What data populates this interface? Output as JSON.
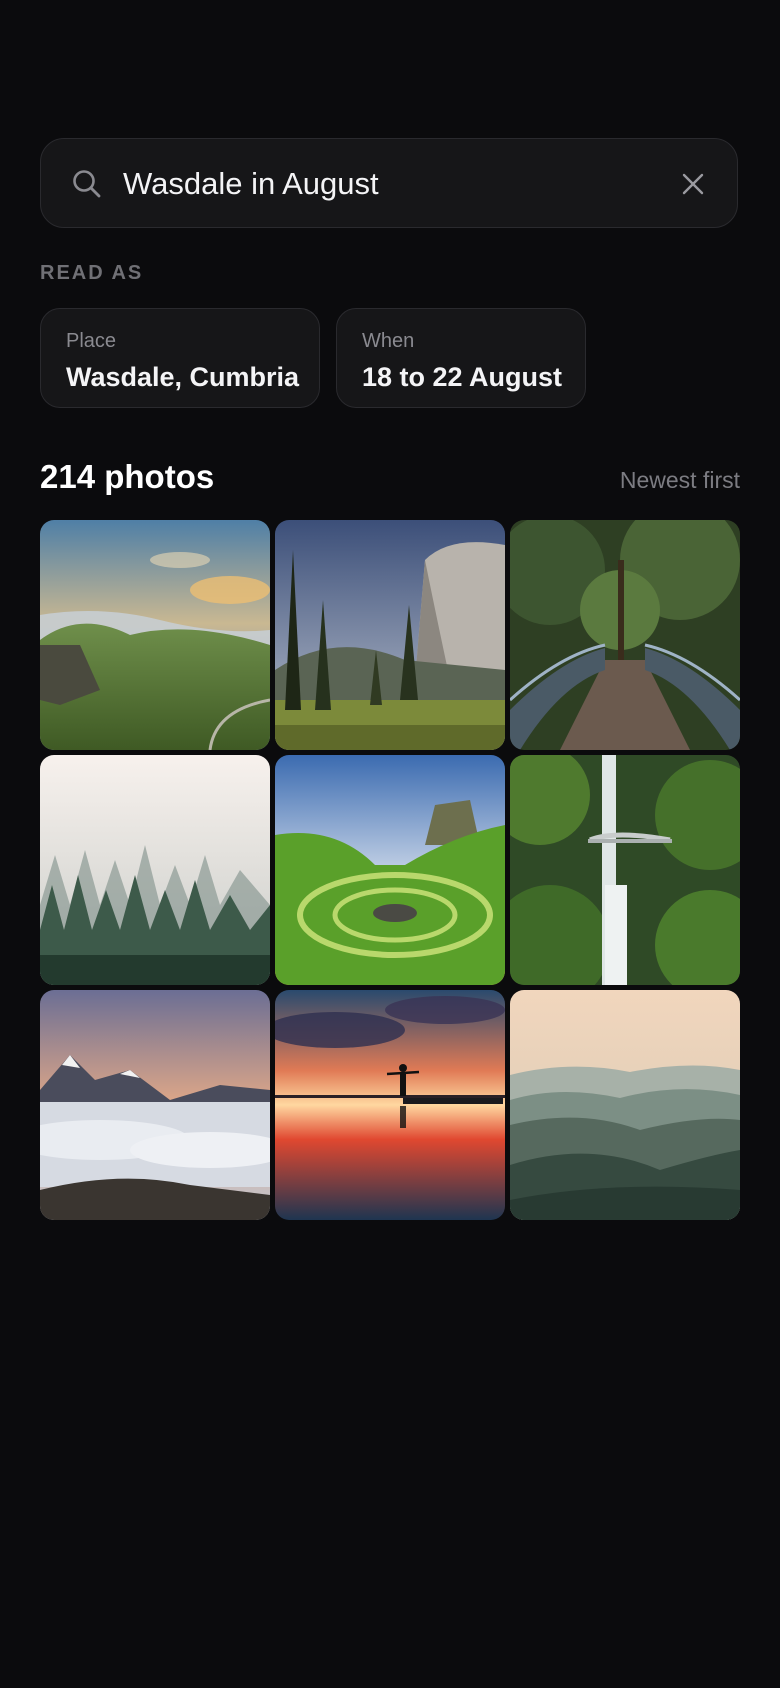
{
  "search": {
    "query": "Wasdale in August",
    "icon": "search-icon",
    "clear_icon": "close-icon"
  },
  "interpretation": {
    "label": "READ AS",
    "chips": [
      {
        "key": "Place",
        "value": "Wasdale, Cumbria"
      },
      {
        "key": "When",
        "value": "18 to 22 August"
      }
    ]
  },
  "results": {
    "count_label": "214 photos",
    "sort_label": "Newest first"
  },
  "photos": [
    {
      "subject": "green valley with clouds at sunset"
    },
    {
      "subject": "granite cliff with pine trees"
    },
    {
      "subject": "wooden footbridge in forest"
    },
    {
      "subject": "misty pine forest"
    },
    {
      "subject": "green spiral of stones in valley at sunset"
    },
    {
      "subject": "waterfall with bridge"
    },
    {
      "subject": "snowy peaks above sea of clouds"
    },
    {
      "subject": "person silhouette reflected at sunset"
    },
    {
      "subject": "hazy layered hills"
    }
  ],
  "colors": {
    "background": "#0b0b0d",
    "surface": "#161618",
    "border": "#2a2a2e",
    "muted_text": "#7c7c82"
  }
}
